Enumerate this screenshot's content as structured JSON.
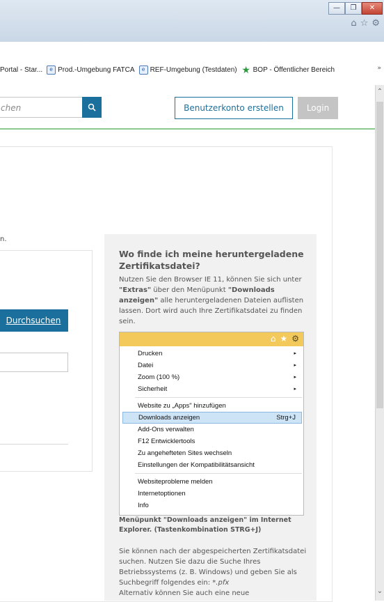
{
  "window": {
    "controls": {
      "minimize": "—",
      "maximize": "❐",
      "close": "✕"
    },
    "toolbar_icons": [
      "home-icon",
      "star-icon",
      "gear-icon"
    ]
  },
  "favorites": {
    "items": [
      {
        "label": "Portal - Star...",
        "icon": "ie-page-icon"
      },
      {
        "label": "Prod.-Umgebung FATCA",
        "icon": "ie-page-icon"
      },
      {
        "label": "REF-Umgebung (Testdaten)",
        "icon": "ie-page-icon"
      },
      {
        "label": "BOP - Öffentlicher Bereich",
        "icon": "green-star-icon"
      }
    ],
    "more": "»"
  },
  "header": {
    "search_placeholder": "chen",
    "search_icon": "search-icon",
    "register_label": "Benutzerkonto erstellen",
    "login_label": "Login"
  },
  "main": {
    "lead_fragment": "n.",
    "browse_label": "Durchsuchen"
  },
  "side": {
    "title": "Wo finde ich meine heruntergeladene Zertifikatsdatei?",
    "intro_1": "Nutzen Sie den Browser IE 11, können Sie sich unter ",
    "intro_extras": "\"Extras\"",
    "intro_2": " über den Menüpunkt ",
    "intro_downloads": "\"Downloads anzeigen\"",
    "intro_3": " alle heruntergeladenen Dateien auflisten lassen. Dort wird auch Ihre Zertifikatsdatei zu finden sein.",
    "menu": {
      "groups": [
        [
          {
            "label": "Drucken",
            "arrow": "▸"
          },
          {
            "label": "Datei",
            "arrow": "▸"
          },
          {
            "label": "Zoom (100 %)",
            "arrow": "▸"
          },
          {
            "label": "Sicherheit",
            "arrow": "▸"
          }
        ],
        [
          {
            "label": "Website zu „Apps\" hinzufügen"
          },
          {
            "label": "Downloads anzeigen",
            "shortcut": "Strg+J",
            "highlighted": true
          },
          {
            "label": "Add-Ons verwalten"
          },
          {
            "label": "F12 Entwicklertools"
          },
          {
            "label": "Zu angehefteten Sites wechseln"
          },
          {
            "label": "Einstellungen der Kompatibilitätsansicht"
          }
        ],
        [
          {
            "label": "Websiteprobleme melden"
          },
          {
            "label": "Internetoptionen"
          },
          {
            "label": "Info"
          }
        ]
      ]
    },
    "caption": "Menüpunkt \"Downloads anzeigen\" im Internet Explorer. (Tastenkombination STRG+J)",
    "text2_1": "Sie können nach der abgespeicherten Zertifikatsdatei suchen. Nutzen Sie dazu die Suche Ihres Betriebssystems (z. B. Windows) und geben Sie als Suchbegriff folgendes ein: ",
    "text2_pfx": "*.pfx",
    "text2_2": "Alternativ können Sie auch eine neue"
  },
  "colors": {
    "accent": "#1b6f9d",
    "header_rule": "#8cc98f",
    "login_disabled": "#c4c4c4",
    "menu_bar": "#f2c95a"
  }
}
